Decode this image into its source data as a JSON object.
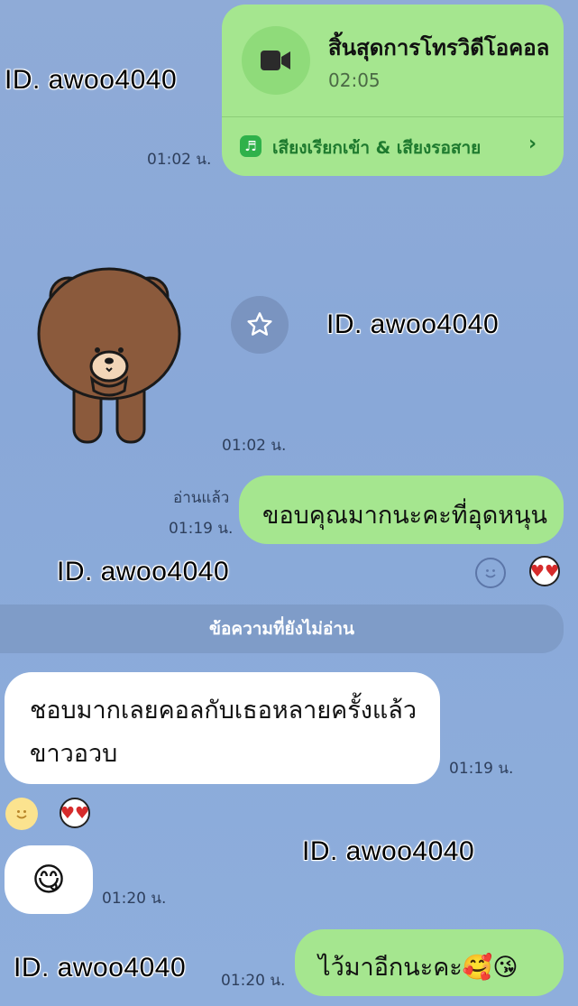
{
  "watermark": "ID. awoo4040",
  "call_card": {
    "title": "สิ้นสุดการโทรวิดีโอคอล",
    "duration": "02:05",
    "ringtone_label": "เสียงเรียกเข้า & เสียงรอสาย",
    "time": "01:02 น."
  },
  "sticker": {
    "time": "01:02 น."
  },
  "sent_message_1": {
    "text": "ขอบคุณมากนะคะที่อุดหนุน",
    "read_status": "อ่านแล้ว",
    "time": "01:19 น."
  },
  "unread_divider": "ข้อความที่ยังไม่อ่าน",
  "received_message_1": {
    "line1": "ชอบมากเลยคอลกับเธอหลายครั้งแล้ว",
    "line2": "ขาวอวบ",
    "time": "01:19 น."
  },
  "received_message_2": {
    "emoji": "😋",
    "time": "01:20 น."
  },
  "sent_message_2": {
    "text": "ไว้มาอีกนะคะ🥰😘",
    "time": "01:20 น."
  },
  "colors": {
    "bubble_green": "#a5e68f",
    "bubble_white": "#ffffff",
    "background": "#8eaedc",
    "divider": "#7f9cc8"
  }
}
